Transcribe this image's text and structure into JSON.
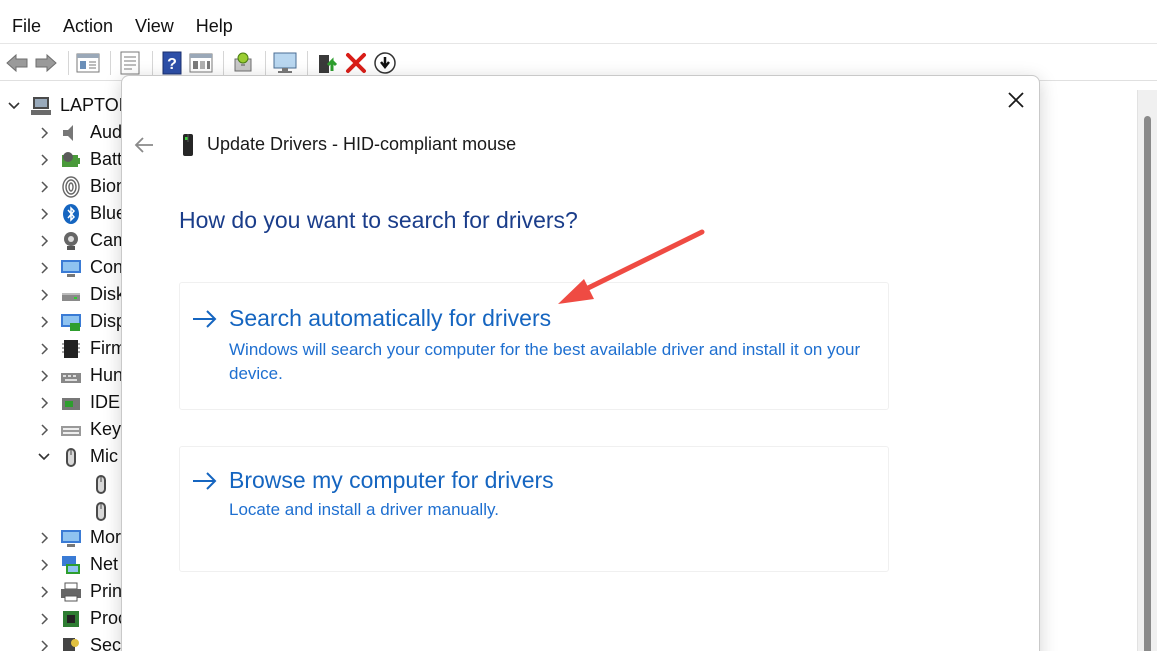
{
  "menu": [
    "File",
    "Action",
    "View",
    "Help"
  ],
  "toolbar_icons": [
    "back-arrow-icon",
    "forward-arrow-icon",
    "show-hide-tree-icon",
    "properties-icon",
    "help-icon",
    "view-icon",
    "scan-hardware-icon",
    "monitor-icon",
    "update-driver-icon",
    "uninstall-icon",
    "download-icon"
  ],
  "tree": {
    "root": "LAPTOP",
    "items": [
      {
        "label": "Aud",
        "icon": "speaker-icon",
        "state": "collapsed"
      },
      {
        "label": "Batt",
        "icon": "battery-icon",
        "state": "collapsed"
      },
      {
        "label": "Bion",
        "icon": "fingerprint-icon",
        "state": "collapsed"
      },
      {
        "label": "Blue",
        "icon": "bluetooth-icon",
        "state": "collapsed"
      },
      {
        "label": "Cam",
        "icon": "camera-icon",
        "state": "collapsed"
      },
      {
        "label": "Con",
        "icon": "computer-icon",
        "state": "collapsed"
      },
      {
        "label": "Disk",
        "icon": "disk-drive-icon",
        "state": "collapsed"
      },
      {
        "label": "Disp",
        "icon": "display-adapter-icon",
        "state": "collapsed"
      },
      {
        "label": "Firm",
        "icon": "firmware-icon",
        "state": "collapsed"
      },
      {
        "label": "Hun",
        "icon": "hid-icon",
        "state": "collapsed"
      },
      {
        "label": "IDE",
        "icon": "ide-controller-icon",
        "state": "collapsed"
      },
      {
        "label": "Key",
        "icon": "keyboard-icon",
        "state": "collapsed"
      },
      {
        "label": "Mic",
        "icon": "mouse-icon",
        "state": "expanded"
      },
      {
        "label": "",
        "icon": "mouse-icon",
        "state": "child"
      },
      {
        "label": "",
        "icon": "mouse-icon",
        "state": "child"
      },
      {
        "label": "Mor",
        "icon": "monitor-icon",
        "state": "collapsed"
      },
      {
        "label": "Net",
        "icon": "network-icon",
        "state": "collapsed"
      },
      {
        "label": "Prin",
        "icon": "printer-icon",
        "state": "collapsed"
      },
      {
        "label": "Proc",
        "icon": "processor-icon",
        "state": "collapsed"
      },
      {
        "label": "Secu",
        "icon": "security-device-icon",
        "state": "collapsed"
      }
    ]
  },
  "dialog": {
    "title": "Update Drivers - HID-compliant mouse",
    "question": "How do you want to search for drivers?",
    "options": [
      {
        "title": "Search automatically for drivers",
        "description": "Windows will search your computer for the best available driver and install it on your device."
      },
      {
        "title": "Browse my computer for drivers",
        "description": "Locate and install a driver manually."
      }
    ]
  },
  "colors": {
    "question": "#1a3d8a",
    "option_title": "#1565c0",
    "option_desc": "#1e6fd0",
    "annotation_arrow": "#ef4b43"
  }
}
